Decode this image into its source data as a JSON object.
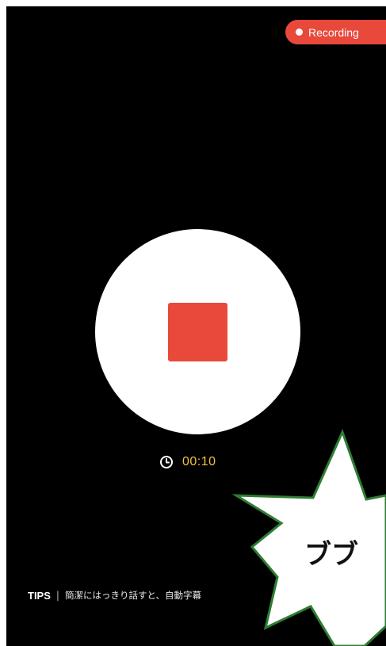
{
  "status_badge": {
    "label": "Recording",
    "color": "#e8493b"
  },
  "record_control": {
    "icon": "stop-icon",
    "stop_color": "#e8493b"
  },
  "timer": {
    "icon": "clock-icon",
    "elapsed": "00:10",
    "color": "#f2c13b"
  },
  "tips": {
    "label": "TIPS",
    "separator": "|",
    "text": "簡潔にはっきり話すと、自動字幕"
  },
  "overlay": {
    "shape": "star",
    "text": "ブブ",
    "fill": "#ffffff",
    "outline": "#2e7d32"
  }
}
